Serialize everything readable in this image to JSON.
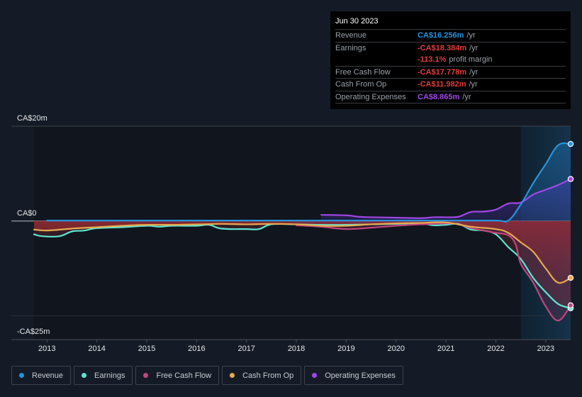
{
  "chart_data": {
    "type": "line",
    "title": "",
    "xlabel": "",
    "ylabel": "",
    "units": "CA$ millions",
    "ylim": [
      -25,
      20
    ],
    "xlim": [
      2012.74,
      2023.5
    ],
    "y_ticks": [
      {
        "value": 20,
        "label": "CA$20m"
      },
      {
        "value": 0,
        "label": "CA$0"
      },
      {
        "value": -25,
        "label": "-CA$25m"
      }
    ],
    "x_ticks": [
      2013,
      2014,
      2015,
      2016,
      2017,
      2018,
      2019,
      2020,
      2021,
      2022,
      2023
    ],
    "x_tick_labels": [
      "2013",
      "2014",
      "2015",
      "2016",
      "2017",
      "2018",
      "2019",
      "2020",
      "2021",
      "2022",
      "2023"
    ],
    "highlight_range": [
      2022.5,
      2023.5
    ],
    "legend_position": "bottom",
    "series": [
      {
        "name": "Revenue",
        "color": "#2394df",
        "x": [
          2013.0,
          2014,
          2015,
          2016,
          2017,
          2018,
          2019,
          2020,
          2021,
          2022.0,
          2022.25,
          2022.5,
          2022.75,
          2023.0,
          2023.25,
          2023.5
        ],
        "values": [
          0.1,
          0.1,
          0.1,
          0.1,
          0.1,
          0.1,
          0.1,
          0.1,
          0.1,
          0.1,
          0.1,
          3.5,
          8.0,
          12.0,
          16.0,
          16.256
        ]
      },
      {
        "name": "Earnings",
        "color": "#5ee6d2",
        "x": [
          2012.74,
          2012.9,
          2013.25,
          2013.5,
          2013.75,
          2014.0,
          2014.5,
          2015.0,
          2015.25,
          2015.5,
          2016.0,
          2016.25,
          2016.5,
          2017.0,
          2017.25,
          2017.5,
          2018.0,
          2018.5,
          2019.0,
          2019.5,
          2020.0,
          2020.5,
          2020.75,
          2021.0,
          2021.25,
          2021.5,
          2021.75,
          2022.0,
          2022.25,
          2022.5,
          2022.75,
          2023.0,
          2023.25,
          2023.5
        ],
        "values": [
          -2.8,
          -3.2,
          -3.2,
          -2.2,
          -2.0,
          -1.5,
          -1.3,
          -1.0,
          -1.2,
          -1.0,
          -1.0,
          -0.8,
          -1.6,
          -1.7,
          -1.7,
          -0.7,
          -0.7,
          -0.8,
          -0.8,
          -0.7,
          -0.6,
          -0.5,
          -0.9,
          -0.8,
          -0.6,
          -1.8,
          -2.0,
          -2.8,
          -5.5,
          -8.0,
          -12.0,
          -15.0,
          -17.5,
          -18.384
        ]
      },
      {
        "name": "Free Cash Flow",
        "color": "#c2457e",
        "x": [
          2018.0,
          2018.5,
          2019.0,
          2019.5,
          2020.0,
          2020.5,
          2021.0,
          2021.25,
          2021.5,
          2021.75,
          2022.0,
          2022.25,
          2022.4,
          2022.5,
          2022.75,
          2023.0,
          2023.25,
          2023.5
        ],
        "values": [
          -0.9,
          -1.2,
          -1.7,
          -1.4,
          -1.0,
          -0.7,
          -0.5,
          -0.7,
          -1.5,
          -2.0,
          -2.5,
          -3.0,
          -5.0,
          -9.0,
          -13.0,
          -18.0,
          -21.0,
          -17.778
        ]
      },
      {
        "name": "Cash From Op",
        "color": "#e8a94f",
        "x": [
          2012.74,
          2013.0,
          2013.5,
          2014.0,
          2014.5,
          2015.0,
          2015.5,
          2016.0,
          2016.5,
          2017.0,
          2017.5,
          2018.0,
          2018.5,
          2019.0,
          2019.5,
          2020.0,
          2020.5,
          2021.0,
          2021.5,
          2022.0,
          2022.25,
          2022.5,
          2022.75,
          2023.0,
          2023.25,
          2023.5
        ],
        "values": [
          -1.8,
          -2.0,
          -1.6,
          -1.3,
          -1.0,
          -0.8,
          -0.8,
          -0.7,
          -0.6,
          -0.7,
          -0.6,
          -0.7,
          -1.0,
          -1.0,
          -0.7,
          -0.5,
          -0.4,
          -0.3,
          -1.2,
          -1.7,
          -2.5,
          -4.5,
          -6.5,
          -10.0,
          -13.0,
          -11.982
        ]
      },
      {
        "name": "Operating Expenses",
        "color": "#a246e8",
        "x": [
          2018.5,
          2019.0,
          2019.25,
          2019.5,
          2020.0,
          2020.5,
          2020.75,
          2021.0,
          2021.25,
          2021.5,
          2021.75,
          2022.0,
          2022.25,
          2022.5,
          2022.75,
          2023.0,
          2023.25,
          2023.5
        ],
        "values": [
          1.3,
          1.2,
          0.9,
          0.8,
          0.7,
          0.6,
          0.8,
          0.8,
          0.9,
          1.9,
          2.0,
          2.4,
          3.7,
          3.9,
          5.6,
          6.6,
          7.6,
          8.865
        ]
      }
    ]
  },
  "tooltip": {
    "date": "Jun 30 2023",
    "rows": [
      {
        "label": "Revenue",
        "value": "CA$16.256m",
        "suffix": "/yr",
        "color": "#2394df"
      },
      {
        "label": "Earnings",
        "value": "-CA$18.384m",
        "suffix": "/yr",
        "color": "#e23b3b"
      },
      {
        "label": "",
        "value": "-113.1%",
        "suffix": "profit margin",
        "color": "#e23b3b"
      },
      {
        "label": "Free Cash Flow",
        "value": "-CA$17.778m",
        "suffix": "/yr",
        "color": "#e23b3b"
      },
      {
        "label": "Cash From Op",
        "value": "-CA$11.982m",
        "suffix": "/yr",
        "color": "#e23b3b"
      },
      {
        "label": "Operating Expenses",
        "value": "CA$8.865m",
        "suffix": "/yr",
        "color": "#a246e8"
      }
    ]
  },
  "legend": [
    {
      "label": "Revenue",
      "color": "#2394df"
    },
    {
      "label": "Earnings",
      "color": "#5ee6d2"
    },
    {
      "label": "Free Cash Flow",
      "color": "#c2457e"
    },
    {
      "label": "Cash From Op",
      "color": "#e8a94f"
    },
    {
      "label": "Operating Expenses",
      "color": "#a246e8"
    }
  ]
}
